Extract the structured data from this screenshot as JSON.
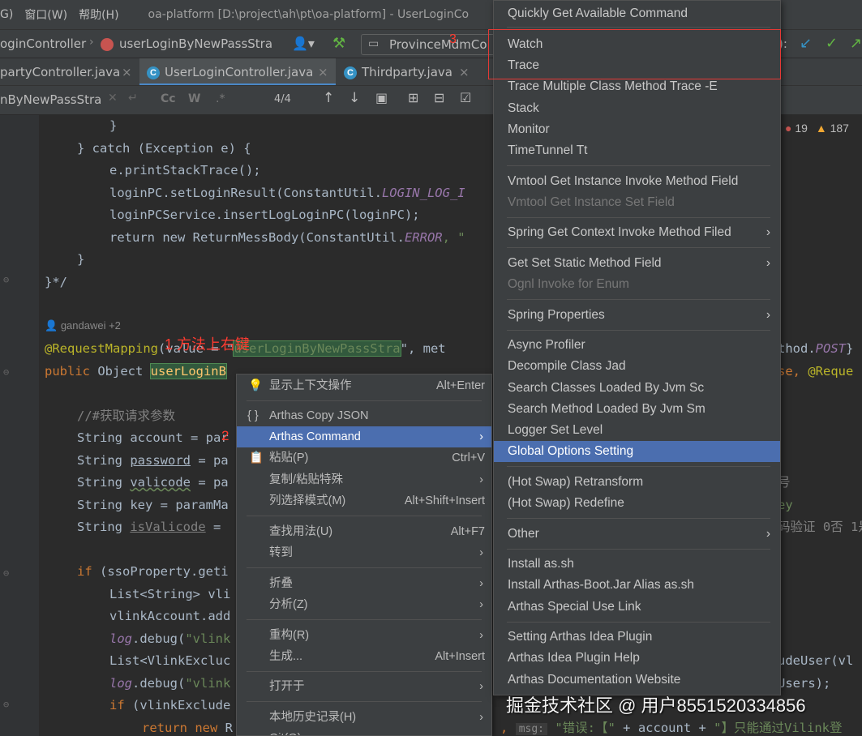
{
  "menubar": {
    "items": [
      "G)",
      "窗口(W)",
      "帮助(H)"
    ],
    "title": "oa-platform [D:\\project\\ah\\pt\\oa-platform] - UserLoginCo"
  },
  "navbar": {
    "crumb1": "oginController",
    "crumb2": "userLoginByNewPassStra",
    "run_config": "ProvinceMdmCo",
    "right_text": "):"
  },
  "tabs": [
    {
      "label": "partyController.java"
    },
    {
      "label": "UserLoginController.java"
    },
    {
      "label": "Thirdparty.java"
    }
  ],
  "findbar": {
    "query": "nByNewPassStra",
    "cc": "Cc",
    "w": "W",
    "regex": ".*",
    "count": "4/4"
  },
  "inspections": {
    "errors": "19",
    "warnings": "187"
  },
  "author": "gandawei +2",
  "code": {
    "l1": "}",
    "l2_kw": "} catch",
    "l2_rest": " (Exception e) {",
    "l3": "e.printStackTrace();",
    "l4_a": "loginPC.setLoginResult(ConstantUtil.",
    "l4_b": "LOGIN_LOG_I",
    "l5": "loginPCService.insertLogLoginPC(loginPC);",
    "l6_kw": "return new",
    "l6_rest": " ReturnMessBody(ConstantUtil.",
    "l6_fld": "ERROR",
    "l6_end": ", \"",
    "l7": "}",
    "l8": "}*/",
    "req_ann": "@RequestMapping",
    "req_a": "(value = \"",
    "req_str": "userLoginByNewPassStra",
    "req_b": "\", met",
    "req_right_a": "thod.",
    "req_right_b": "POST",
    "req_right_c": "}",
    "pub_kw": "public",
    "pub_type": " Object ",
    "pub_name": "userLoginB",
    "pub_right_a": "se, ",
    "pub_right_b": "@Reque",
    "comment": "//#获取请求参数",
    "s1_type": "String ",
    "s1_var": "account",
    "s1_eq": " = par",
    "s2_var": "password",
    "s2_eq": " = pa",
    "s3_var": "valicode",
    "s3_eq": " = pa",
    "s4_var": "key",
    "s4_eq": " = paramMa",
    "s5_var": "isValicode",
    "s5_eq": " = ",
    "if1_kw": "if",
    "if1_rest": " (ssoProperty.geti",
    "l_list1": "List<String> vli",
    "l_vadd": "vlinkAccount.add",
    "l_log1_a": "log",
    "l_log1_b": ".debug(",
    "l_log1_c": "\"vlink",
    "l_list2": "List<VlinkExcluc",
    "l_log2_a": "log",
    "l_log2_b": ".debug(",
    "l_log2_c": "\"vlink",
    "l_if2_kw": "if",
    "l_if2_rest": " (vlinkExclude",
    "l_ret_kw": "return new",
    "l_ret_rest": " R",
    "right_s4": "ey",
    "right_s5": "码验证 0否 1是",
    "right_list2": "udeUser(vl",
    "right_log2": "Users);",
    "right_misc": "号",
    "bottom_a": ",",
    "bottom_msg": "msg:",
    "bottom_str1": "\"错误:【\"",
    "bottom_plus1": " + account + ",
    "bottom_str2": "\"】只能通过Vilink登"
  },
  "annotations": {
    "step1": "1 方法上右键",
    "step2": "2",
    "step3": "3"
  },
  "context_menu": {
    "items": [
      {
        "label": "显示上下文操作",
        "shortcut": "Alt+Enter"
      },
      {
        "label": "Arthas Copy JSON"
      },
      {
        "label": "Arthas Command"
      },
      {
        "label": "粘贴(P)",
        "shortcut": "Ctrl+V"
      },
      {
        "label": "复制/粘贴特殊"
      },
      {
        "label": "列选择模式(M)",
        "shortcut": "Alt+Shift+Insert"
      },
      {
        "label": "查找用法(U)",
        "shortcut": "Alt+F7"
      },
      {
        "label": "转到"
      },
      {
        "label": "折叠"
      },
      {
        "label": "分析(Z)"
      },
      {
        "label": "重构(R)"
      },
      {
        "label": "生成...",
        "shortcut": "Alt+Insert"
      },
      {
        "label": "打开于"
      },
      {
        "label": "本地历史记录(H)"
      },
      {
        "label": "Git(G)"
      }
    ]
  },
  "submenu": {
    "items": [
      {
        "label": "Quickly Get Available Command"
      },
      {
        "label": "Watch"
      },
      {
        "label": "Trace"
      },
      {
        "label": "Trace Multiple Class Method Trace -E"
      },
      {
        "label": "Stack"
      },
      {
        "label": "Monitor"
      },
      {
        "label": "TimeTunnel Tt"
      },
      {
        "label": "Vmtool Get Instance Invoke Method Field"
      },
      {
        "label": "Vmtool Get Instance Set Field"
      },
      {
        "label": "Spring Get Context Invoke Method Filed"
      },
      {
        "label": "Get Set Static Method Field"
      },
      {
        "label": "Ognl Invoke for Enum"
      },
      {
        "label": "Spring Properties"
      },
      {
        "label": "Async Profiler"
      },
      {
        "label": "Decompile Class Jad"
      },
      {
        "label": "Search Classes Loaded By Jvm Sc"
      },
      {
        "label": "Search Method Loaded By Jvm Sm"
      },
      {
        "label": "Logger Set Level"
      },
      {
        "label": "Global Options Setting"
      },
      {
        "label": "(Hot Swap) Retransform"
      },
      {
        "label": "(Hot Swap) Redefine"
      },
      {
        "label": "Other"
      },
      {
        "label": "Install as.sh"
      },
      {
        "label": "Install Arthas-Boot.Jar Alias as.sh"
      },
      {
        "label": "Arthas Special Use Link"
      },
      {
        "label": "Setting Arthas Idea Plugin"
      },
      {
        "label": "Arthas Idea Plugin Help"
      },
      {
        "label": "Arthas Documentation Website"
      }
    ]
  },
  "watermark": "掘金技术社区 @ 用户8551520334856",
  "colors": {
    "selection": "#4b6eaf",
    "menu_bg": "#3c3f41",
    "editor_bg": "#2b2b2b",
    "annotation_red": "#ff3b30"
  }
}
